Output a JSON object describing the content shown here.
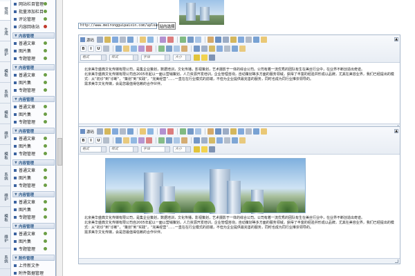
{
  "tabstrip": {
    "tabs": [
      "常规",
      "生成",
      "维护",
      "模板",
      "系统",
      "模板",
      "维护",
      "模板",
      "系统",
      "维护",
      "模板",
      "维护",
      "系统"
    ]
  },
  "sidebar": {
    "top_items": [
      {
        "label": "网站栏目管理",
        "icon": "add"
      },
      {
        "label": "批量添加栏目",
        "icon": "add"
      },
      {
        "label": "评论管理",
        "icon": "add"
      },
      {
        "label": "内容回收站",
        "icon": "delete"
      }
    ],
    "sections": [
      {
        "title": "内容管理",
        "items": [
          "普通文章",
          "图片集",
          "专题管理"
        ]
      },
      {
        "title": "内容管理",
        "items": [
          "普通文章",
          "图片集",
          "专题管理"
        ]
      },
      {
        "title": "内容管理",
        "items": [
          "普通文章",
          "图片集",
          "专题管理"
        ]
      },
      {
        "title": "内容管理",
        "items": [
          "普通文章",
          "图片集",
          "专题管理"
        ]
      },
      {
        "title": "内容管理",
        "items": [
          "普通文章",
          "图片集",
          "专题管理"
        ]
      },
      {
        "title": "内容管理",
        "items": [
          "普通文章",
          "图片集",
          "专题管理"
        ]
      },
      {
        "title": "内容管理",
        "items": [
          "普通文章",
          "图片集",
          "专题管理"
        ]
      }
    ],
    "attach_section": {
      "title": "附件管理",
      "items": [
        "上传新文件",
        "附件数据管理"
      ]
    }
  },
  "main": {
    "url_value": "http://www.meirongguipaixin.com/uploads/",
    "url_button": "站内选择",
    "editor": {
      "source_label": "源码",
      "format_placeholder": "格式",
      "style_placeholder": "样式",
      "font_placeholder": "字体",
      "size_placeholder": "大小",
      "bold": "B",
      "italic": "I",
      "underline": "U",
      "paragraphs": [
        "北京美华盛典文化传媒有限公司，是集企业策划，数据培训，文化传播，影视策划，艺术摄影于一体的综合公司。公司有着一流优秀的团队有生在美丝行业中，在业界不断创造出奇迹。",
        "北京美华盛典文化传媒有限公司自2005年起以一面以营销策划，人力资源开发培训，企业管理咨询，自动策划等多方面的服务领域，获得了丰富的经验并形成以品牌，尤其在美容业界，我们已经提出的模式：从“初诊”到“诊断”，“策划”到“实践”，“完美经营”……一直在在行业模式的前端，不但为企业提供最完善的服务，同时也成为同行业推崇领导的。",
        "需求美华文化传媒，会是您最值得信赖的合作伙伴。"
      ]
    }
  },
  "colors": {
    "sidebar_header_text": "#2d5a8a",
    "bullet": "#3b63a0",
    "add_icon": "#6b9e45",
    "delete_icon": "#c0392b"
  }
}
